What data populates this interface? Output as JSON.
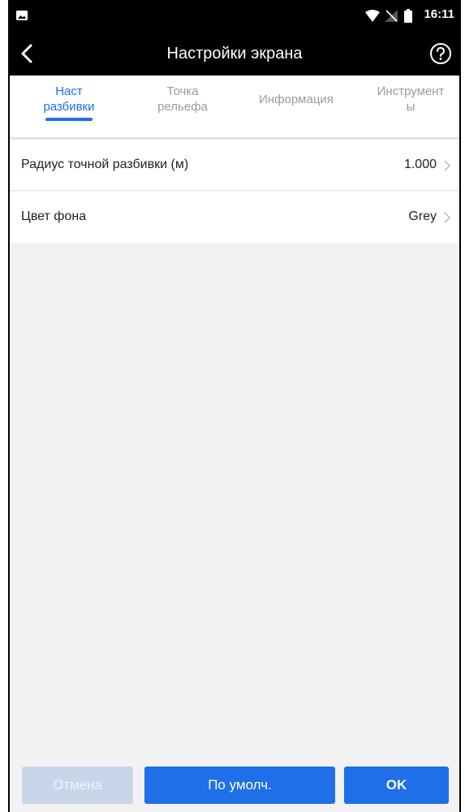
{
  "status_bar": {
    "time": "16:11"
  },
  "app_bar": {
    "title": "Настройки экрана",
    "back_icon": "chevron-left-icon",
    "help_icon": "question-circle-icon"
  },
  "tabs": [
    {
      "line1": "Наст",
      "line2": "разбивки",
      "active": true
    },
    {
      "line1": "Точка",
      "line2": "рельефа",
      "active": false
    },
    {
      "line1": "Информация",
      "line2": "",
      "active": false
    },
    {
      "line1": "Инструмент",
      "line2": "ы",
      "active": false
    }
  ],
  "settings": [
    {
      "label": "Радиус точной разбивки (м)",
      "value": "1.000"
    },
    {
      "label": "Цвет фона",
      "value": "Grey"
    }
  ],
  "buttons": {
    "cancel": "Отмена",
    "default": "По умолч.",
    "ok": "OK"
  },
  "colors": {
    "accent": "#1f6fe8",
    "disabled_button": "#c8d6ea",
    "background": "#f2f2f2",
    "bar": "#000000"
  }
}
